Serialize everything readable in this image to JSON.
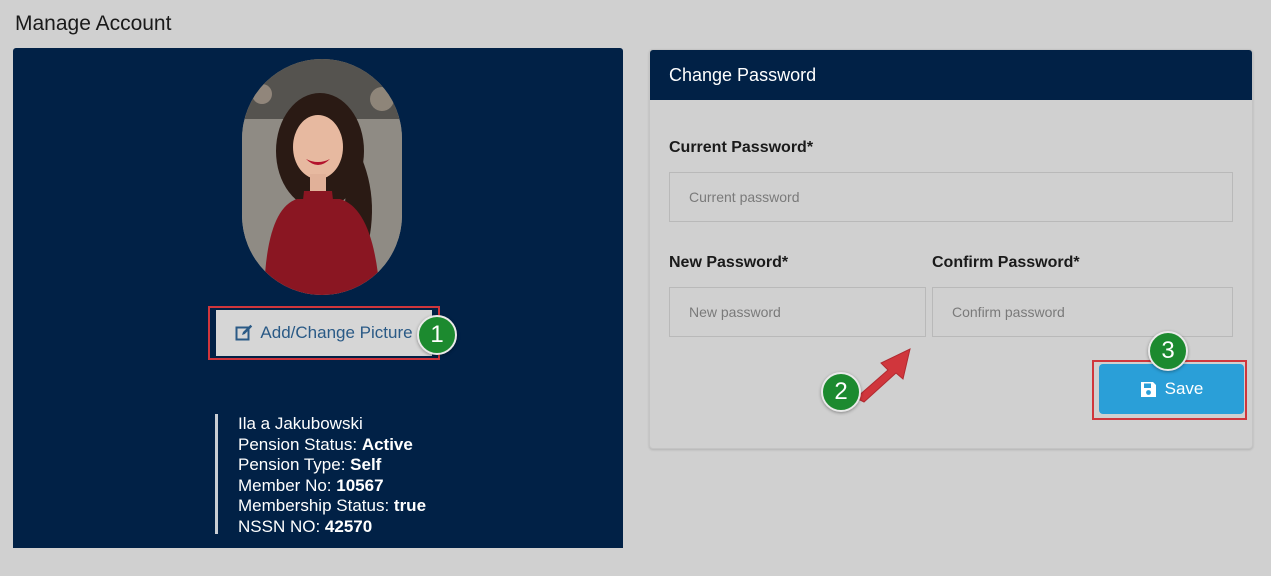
{
  "page": {
    "title": "Manage Account"
  },
  "profile": {
    "change_picture_label": "Add/Change Picture",
    "name": "Ila a Jakubowski",
    "fields": [
      {
        "label": "Pension Status: ",
        "value": "Active"
      },
      {
        "label": "Pension Type: ",
        "value": "Self"
      },
      {
        "label": "Member No: ",
        "value": "10567"
      },
      {
        "label": "Membership Status: ",
        "value": "true"
      },
      {
        "label": "NSSN NO: ",
        "value": "42570"
      }
    ]
  },
  "password_form": {
    "header": "Change Password",
    "current": {
      "label": "Current Password*",
      "placeholder": "Current password"
    },
    "new": {
      "label": "New Password*",
      "placeholder": "New password"
    },
    "confirm": {
      "label": "Confirm Password*",
      "placeholder": "Confirm password"
    },
    "save_label": "Save"
  },
  "annotations": {
    "step1": "1",
    "step2": "2",
    "step3": "3"
  },
  "colors": {
    "navy": "#012146",
    "accent_blue": "#2a9fd8",
    "highlight_red": "#d0363c",
    "step_green": "#1c8a2f"
  }
}
